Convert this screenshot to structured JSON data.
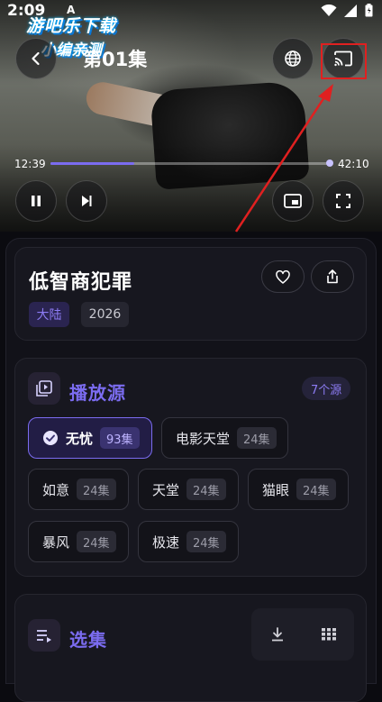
{
  "status_bar": {
    "time": "2:09",
    "indicator": "A"
  },
  "watermark": {
    "line1": "游吧乐下载",
    "line2": "小编亲测"
  },
  "player": {
    "episode_title": "第01集",
    "current_time": "12:39",
    "total_time": "42:10",
    "progress": 0.3
  },
  "show": {
    "title": "低智商犯罪",
    "tags": [
      "大陆",
      "2026"
    ]
  },
  "sources_section": {
    "title": "播放源",
    "count_label": "7个源",
    "sources": [
      {
        "name": "无忧",
        "count": "93集",
        "selected": true
      },
      {
        "name": "电影天堂",
        "count": "24集"
      },
      {
        "name": "如意",
        "count": "24集"
      },
      {
        "name": "天堂",
        "count": "24集"
      },
      {
        "name": "猫眼",
        "count": "24集"
      },
      {
        "name": "暴风",
        "count": "24集"
      },
      {
        "name": "极速",
        "count": "24集"
      }
    ]
  },
  "episodes_section": {
    "title": "选集"
  },
  "colors": {
    "accent": "#7b6cf0",
    "annotation": "#e02020"
  },
  "icons": [
    "back-icon",
    "globe-icon",
    "cast-icon",
    "pause-icon",
    "skip-next-icon",
    "pip-icon",
    "fullscreen-icon",
    "heart-icon",
    "share-icon",
    "playlist-icon",
    "check-icon",
    "episode-list-icon",
    "download-icon",
    "grid-icon"
  ]
}
